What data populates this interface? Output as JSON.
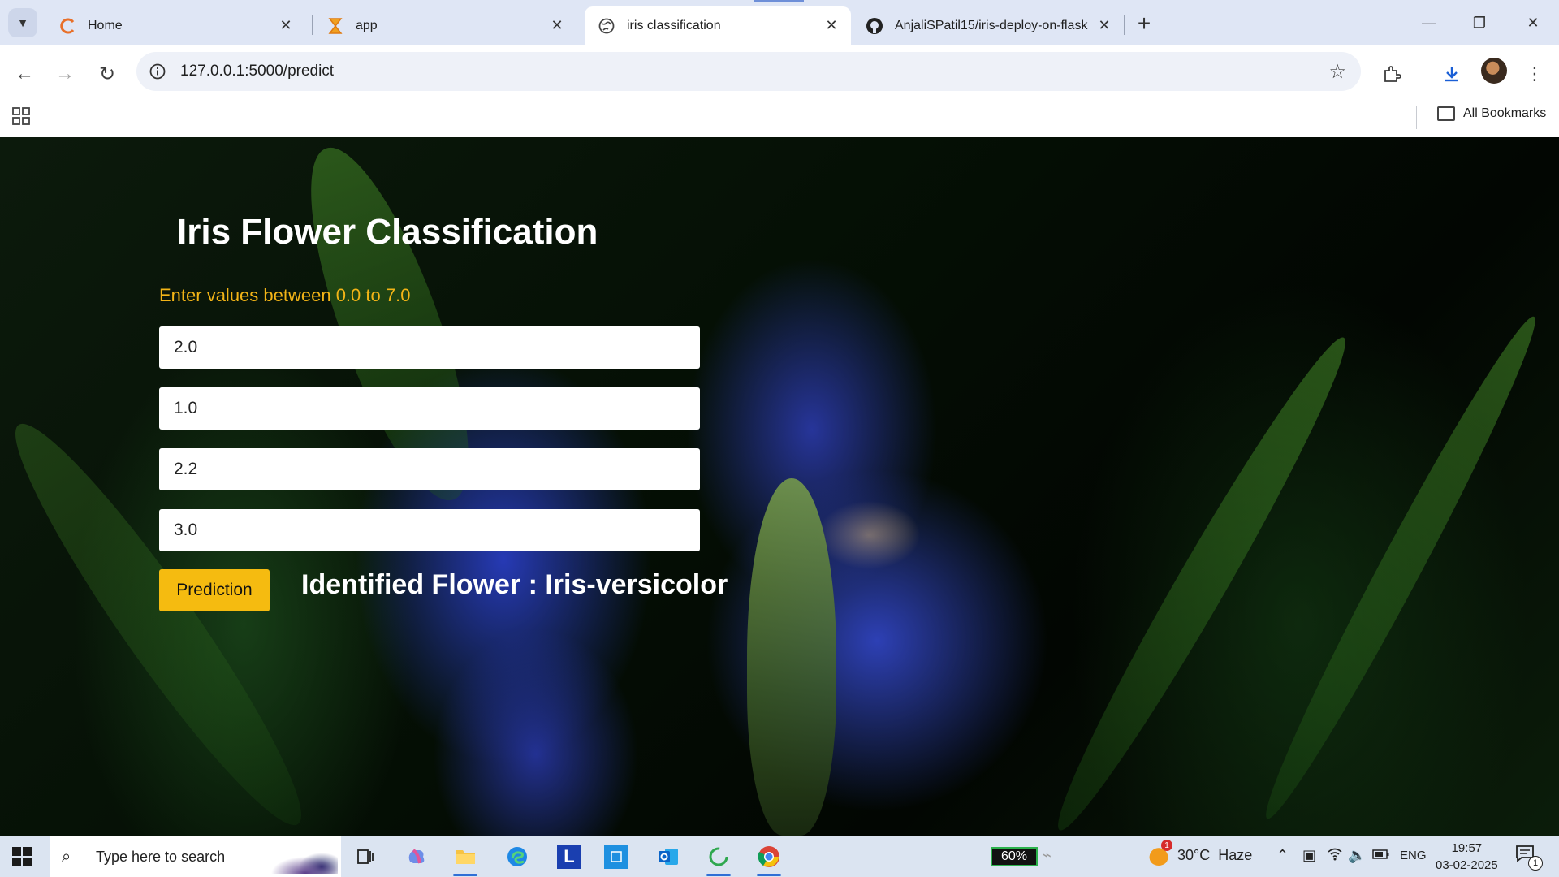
{
  "browser": {
    "tabs": [
      {
        "title": "Home",
        "icon": "loading-icon"
      },
      {
        "title": "app",
        "icon": "hourglass-icon"
      },
      {
        "title": "iris classification",
        "icon": "globe-icon",
        "active": true
      },
      {
        "title": "AnjaliSPatil15/iris-deploy-on-flask",
        "icon": "github-icon"
      }
    ],
    "url": "127.0.0.1:5000/predict",
    "all_bookmarks_label": "All Bookmarks"
  },
  "page": {
    "title": "Iris Flower Classification",
    "hint": "Enter values between 0.0 to 7.0",
    "inputs": [
      "2.0",
      "1.0",
      "2.2",
      "3.0"
    ],
    "button_label": "Prediction",
    "result": "Identified Flower : Iris-versicolor",
    "colors": {
      "hint": "#f2b417",
      "button": "#f5bb10",
      "title": "#ffffff"
    }
  },
  "taskbar": {
    "search_placeholder": "Type here to search",
    "battery_percent": "60%",
    "weather_alert": "1",
    "temperature": "30°C",
    "weather_condition": "Haze",
    "language": "ENG",
    "time": "19:57",
    "date": "03-02-2025",
    "notification_count": "1"
  }
}
